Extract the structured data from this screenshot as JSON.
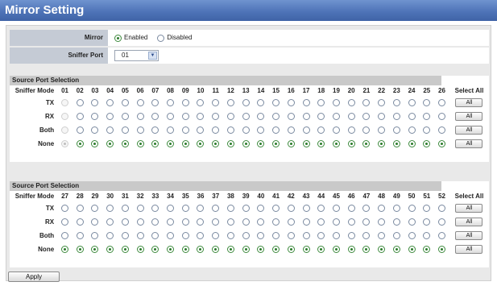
{
  "title": "Mirror Setting",
  "mirror": {
    "label": "Mirror",
    "options": [
      "Enabled",
      "Disabled"
    ],
    "selected": "Enabled"
  },
  "sniffer": {
    "label": "Sniffer Port",
    "value": "01"
  },
  "tables": [
    {
      "title": "Source Port Selection",
      "mode_header": "Sniffer Mode",
      "ports": [
        "01",
        "02",
        "03",
        "04",
        "05",
        "06",
        "07",
        "08",
        "09",
        "10",
        "11",
        "12",
        "13",
        "14",
        "15",
        "16",
        "17",
        "18",
        "19",
        "20",
        "21",
        "22",
        "23",
        "24",
        "25",
        "26"
      ],
      "select_all_header": "Select All",
      "modes": [
        "TX",
        "RX",
        "Both",
        "None"
      ],
      "disabled_port": "01"
    },
    {
      "title": "Source Port Selection",
      "mode_header": "Sniffer Mode",
      "ports": [
        "27",
        "28",
        "29",
        "30",
        "31",
        "32",
        "33",
        "34",
        "35",
        "36",
        "37",
        "38",
        "39",
        "40",
        "41",
        "42",
        "43",
        "44",
        "45",
        "46",
        "47",
        "48",
        "49",
        "50",
        "51",
        "52"
      ],
      "select_all_header": "Select All",
      "modes": [
        "TX",
        "RX",
        "Both",
        "None"
      ],
      "disabled_port": ""
    }
  ],
  "all_button_label": "All",
  "apply_label": "Apply"
}
